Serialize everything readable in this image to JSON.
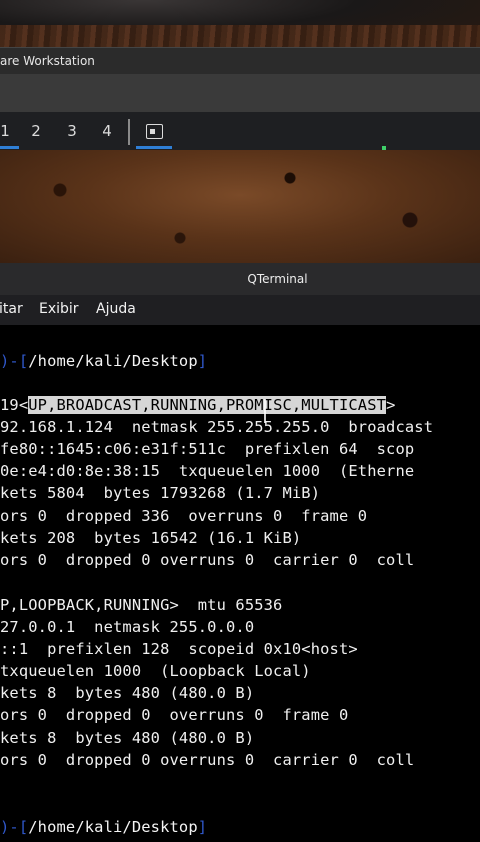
{
  "vm_window": {
    "title": "are Workstation"
  },
  "workspaces": {
    "items": [
      "1",
      "2",
      "3",
      "4"
    ]
  },
  "qterminal": {
    "title": "QTerminal",
    "menu": [
      "itar",
      "Exibir",
      "Ajuda"
    ]
  },
  "terminal": {
    "prompt1": {
      "dash": ")-[",
      "path": "/home/kali/Desktop",
      "close": "]"
    },
    "flags": {
      "prefix": "19<",
      "selected": "UP,BROADCAST,RUNNING,PROMISC,MULTICAST",
      "suffix": ">"
    },
    "lines": [
      "92.168.1.124  netmask 255.255.255.0  broadcast",
      "fe80::1645:c06:e31f:511c  prefixlen 64  scop",
      "0e:e4:d0:8e:38:15  txqueuelen 1000  (Etherne",
      "kets 5804  bytes 1793268 (1.7 MiB)",
      "ors 0  dropped 336  overruns 0  frame 0",
      "kets 208  bytes 16542 (16.1 KiB)",
      "ors 0  dropped 0 overruns 0  carrier 0  coll",
      "",
      "P,LOOPBACK,RUNNING>  mtu 65536",
      "27.0.0.1  netmask 255.0.0.0",
      "::1  prefixlen 128  scopeid 0x10<host>",
      "txqueuelen 1000  (Loopback Local)",
      "kets 8  bytes 480 (480.0 B)",
      "ors 0  dropped 0  overruns 0  frame 0",
      "kets 8  bytes 480 (480.0 B)",
      "ors 0  dropped 0 overruns 0  carrier 0  coll"
    ],
    "prompt2": {
      "dash": ")-[",
      "path": "/home/kali/Desktop",
      "close": "]"
    }
  },
  "colors": {
    "accent": "#2f7fd6",
    "prompt": "#2f57c9",
    "selection": "#d6d6d6"
  }
}
